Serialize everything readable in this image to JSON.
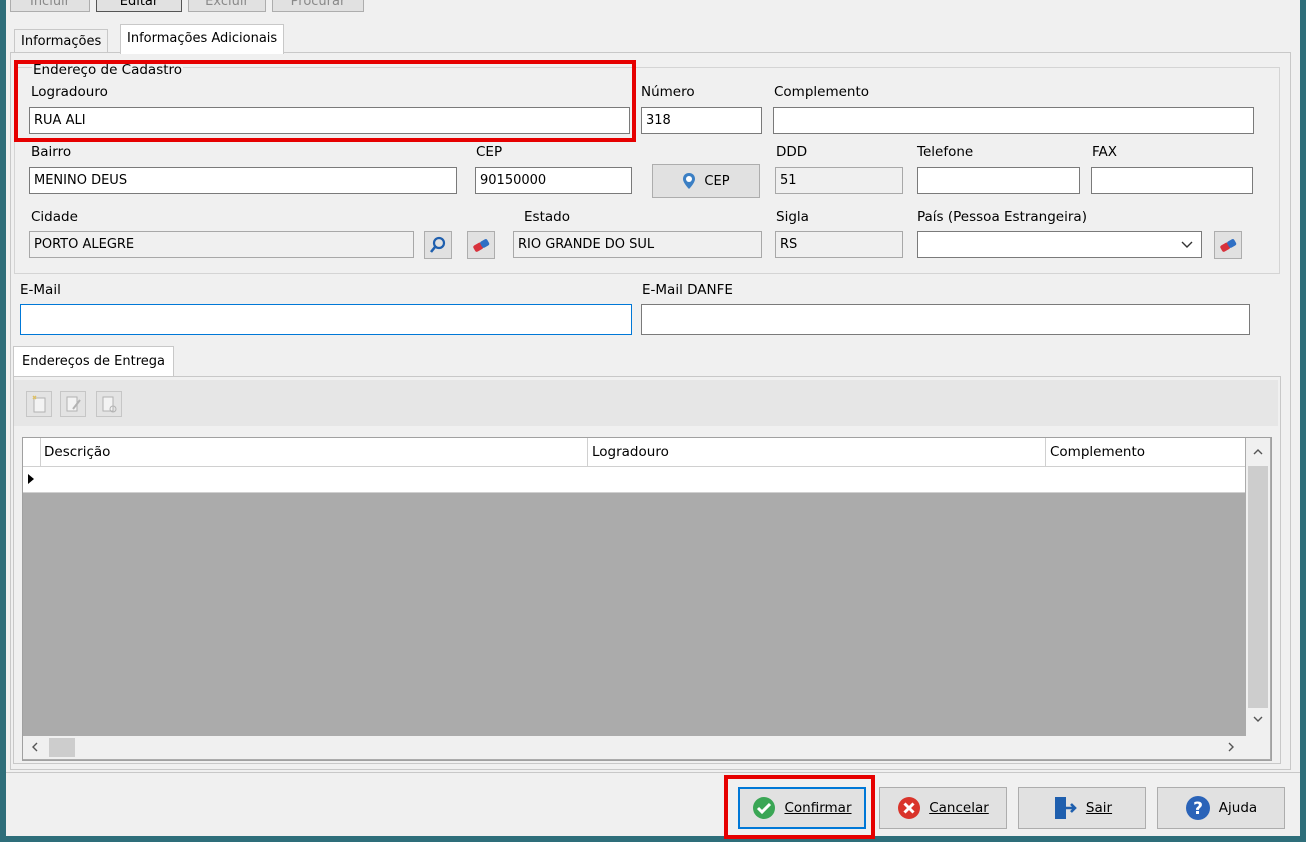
{
  "toolbar": {
    "incluir": "Incluir",
    "editar": "Editar",
    "excluir": "Excluir",
    "procurar": "Procurar"
  },
  "tabs": {
    "info": "Informações",
    "info_adic": "Informações Adicionais"
  },
  "cadastro": {
    "group_title": "Endereço de Cadastro",
    "logradouro_label": "Logradouro",
    "logradouro": "RUA ALI",
    "numero_label": "Número",
    "numero": "318",
    "complemento_label": "Complemento",
    "complemento": "",
    "bairro_label": "Bairro",
    "bairro": "MENINO DEUS",
    "cep_label": "CEP",
    "cep": "90150000",
    "cep_button": "CEP",
    "ddd_label": "DDD",
    "ddd": "51",
    "telefone_label": "Telefone",
    "telefone": "",
    "fax_label": "FAX",
    "fax": "",
    "cidade_label": "Cidade",
    "cidade": "PORTO ALEGRE",
    "estado_label": "Estado",
    "estado": "RIO GRANDE DO SUL",
    "sigla_label": "Sigla",
    "sigla": "RS",
    "pais_label": "País (Pessoa Estrangeira)",
    "pais": ""
  },
  "email": {
    "email_label": "E-Mail",
    "email": "",
    "danfe_label": "E-Mail DANFE",
    "danfe": ""
  },
  "entrega": {
    "tab": "Endereços de Entrega",
    "columns": [
      "Descrição",
      "Logradouro",
      "Complemento"
    ]
  },
  "footer": {
    "confirmar": "Confirmar",
    "cancelar": "Cancelar",
    "sair": "Sair",
    "ajuda": "Ajuda"
  },
  "colors": {
    "accent": "#0078d7",
    "highlight": "#e60000",
    "confirm": "#3aa655",
    "cancel": "#d9342b",
    "help": "#2a63b8"
  }
}
